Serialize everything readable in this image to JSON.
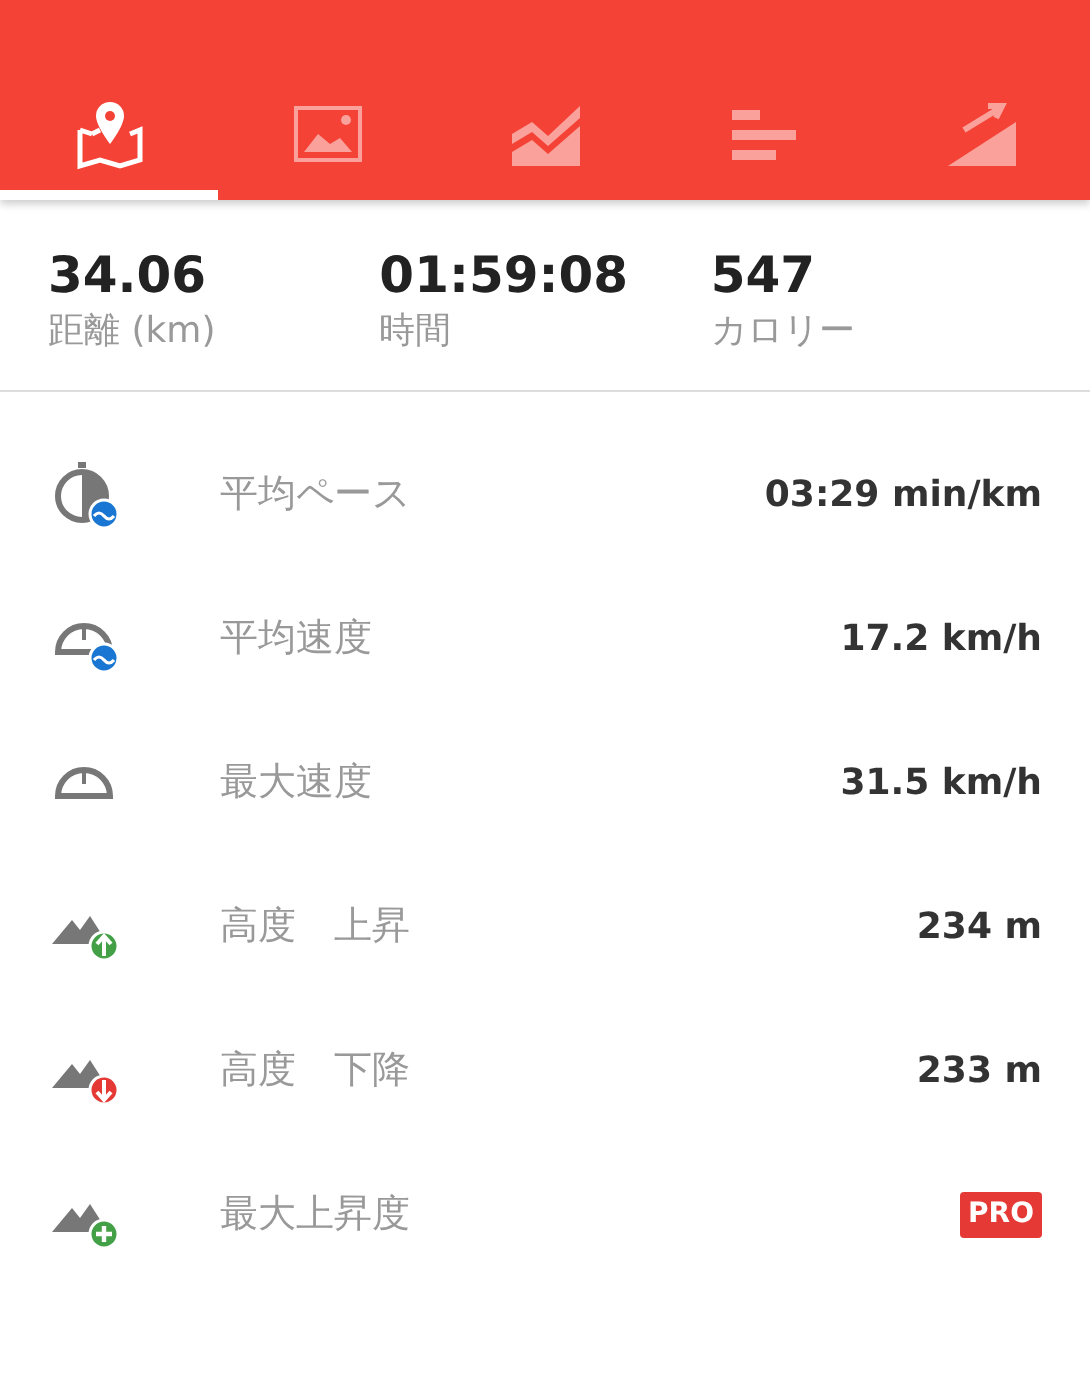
{
  "tabs": [
    {
      "kind": "map",
      "selected": true
    },
    {
      "kind": "photo",
      "selected": false
    },
    {
      "kind": "area-chart",
      "selected": false
    },
    {
      "kind": "bars",
      "selected": false
    },
    {
      "kind": "climb",
      "selected": false
    }
  ],
  "summary": [
    {
      "value": "34.06",
      "label": "距離 (km)"
    },
    {
      "value": "01:59:08",
      "label": "時間"
    },
    {
      "value": "547",
      "label": "カロリー"
    }
  ],
  "stats": [
    {
      "kind": "pace",
      "label": "平均ペース",
      "value": "03:29 min/km"
    },
    {
      "kind": "avg-speed",
      "label": "平均速度",
      "value": "17.2 km/h"
    },
    {
      "kind": "max-speed",
      "label": "最大速度",
      "value": "31.5 km/h"
    },
    {
      "kind": "ascent",
      "label": "高度　上昇",
      "value": "234 m"
    },
    {
      "kind": "descent",
      "label": "高度　下降",
      "value": "233 m"
    },
    {
      "kind": "max-climb",
      "label": "最大上昇度",
      "badge": "PRO"
    }
  ]
}
